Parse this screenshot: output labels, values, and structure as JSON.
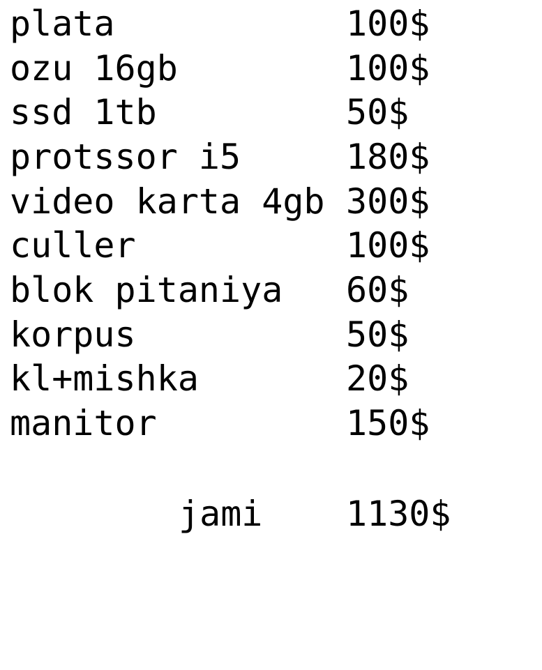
{
  "items": [
    {
      "name": "plata",
      "price": "100$"
    },
    {
      "name": "ozu 16gb",
      "price": "100$"
    },
    {
      "name": "ssd 1tb",
      "price": "50$"
    },
    {
      "name": "protssor i5",
      "price": "180$"
    },
    {
      "name": "video karta 4gb",
      "price": "300$"
    },
    {
      "name": "culler",
      "price": "100$"
    },
    {
      "name": "blok pitaniya",
      "price": "60$"
    },
    {
      "name": "korpus",
      "price": "50$"
    },
    {
      "name": "kl+mishka",
      "price": "20$"
    },
    {
      "name": "manitor",
      "price": "150$"
    }
  ],
  "total": {
    "label": "jami",
    "price": "1130$"
  },
  "colors": {
    "text": "#000000",
    "background": "#ffffff"
  }
}
